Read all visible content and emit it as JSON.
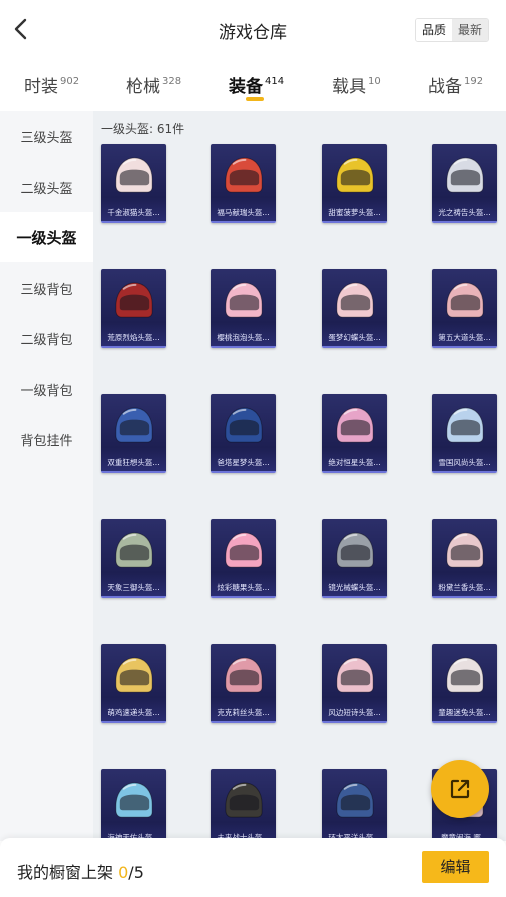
{
  "header": {
    "title": "游戏仓库",
    "sort_quality": "品质",
    "sort_newest": "最新"
  },
  "tabs": [
    {
      "label": "时装",
      "count": "902"
    },
    {
      "label": "枪械",
      "count": "328"
    },
    {
      "label": "装备",
      "count": "414"
    },
    {
      "label": "载具",
      "count": "10"
    },
    {
      "label": "战备",
      "count": "192"
    }
  ],
  "active_tab": "装备",
  "sidebar": {
    "items": [
      "三级头盔",
      "二级头盔",
      "一级头盔",
      "三级背包",
      "二级背包",
      "一级背包",
      "背包挂件"
    ],
    "active": "一级头盔"
  },
  "content": {
    "count_label": "一级头盔: 61件",
    "items": [
      {
        "name": "千金淑猫头盔...",
        "color": "#f1dede"
      },
      {
        "name": "福马献瑞头盔...",
        "color": "#d94b3a"
      },
      {
        "name": "甜蜜菠萝头盔...",
        "color": "#e8c32a"
      },
      {
        "name": "光之祷告头盔...",
        "color": "#d8dbe4"
      },
      {
        "name": "荒原烈焰头盔...",
        "color": "#a52a2a"
      },
      {
        "name": "樱桃泡泡头盔...",
        "color": "#f2b6c9"
      },
      {
        "name": "蛋梦幻蝶头盔...",
        "color": "#f0c9cf"
      },
      {
        "name": "第五大道头盔...",
        "color": "#e9b3b9"
      },
      {
        "name": "双重狂想头盔...",
        "color": "#3a5fb0"
      },
      {
        "name": "爸塔星梦头盔...",
        "color": "#2c4f9a"
      },
      {
        "name": "绝对恒星头盔...",
        "color": "#e7a4c8"
      },
      {
        "name": "雪国风尚头盔...",
        "color": "#b9d2ec"
      },
      {
        "name": "天象三御头盔...",
        "color": "#a9b8a0"
      },
      {
        "name": "炫彩糖果头盔...",
        "color": "#f4a4c0"
      },
      {
        "name": "镜光械蝶头盔...",
        "color": "#9aa0a8"
      },
      {
        "name": "粉黛兰香头盔...",
        "color": "#e8c8cc"
      },
      {
        "name": "萌鸡速递头盔...",
        "color": "#e8c460"
      },
      {
        "name": "克克莉丝头盔...",
        "color": "#e09aa8"
      },
      {
        "name": "风边短诗头盔...",
        "color": "#ecc0cc"
      },
      {
        "name": "童趣迷兔头盔...",
        "color": "#e8e0e0"
      },
      {
        "name": "海神天佑头盔...",
        "color": "#7ec4e4"
      },
      {
        "name": "未来战士头盔...",
        "color": "#3c3a36"
      },
      {
        "name": "环太平洋头盔...",
        "color": "#3b5b98"
      },
      {
        "name": "魔童闹海 哪...",
        "color": "#d8b8c0"
      }
    ]
  },
  "fab": {
    "icon": "share-external-icon"
  },
  "footer": {
    "shelf_label": "我的橱窗上架",
    "shelf_current": "0",
    "shelf_sep_total": "/5",
    "edit_label": "编辑"
  },
  "colors": {
    "accent": "#f2b51a",
    "card_bg": "#24275e",
    "card_border": "#6d74d8"
  }
}
